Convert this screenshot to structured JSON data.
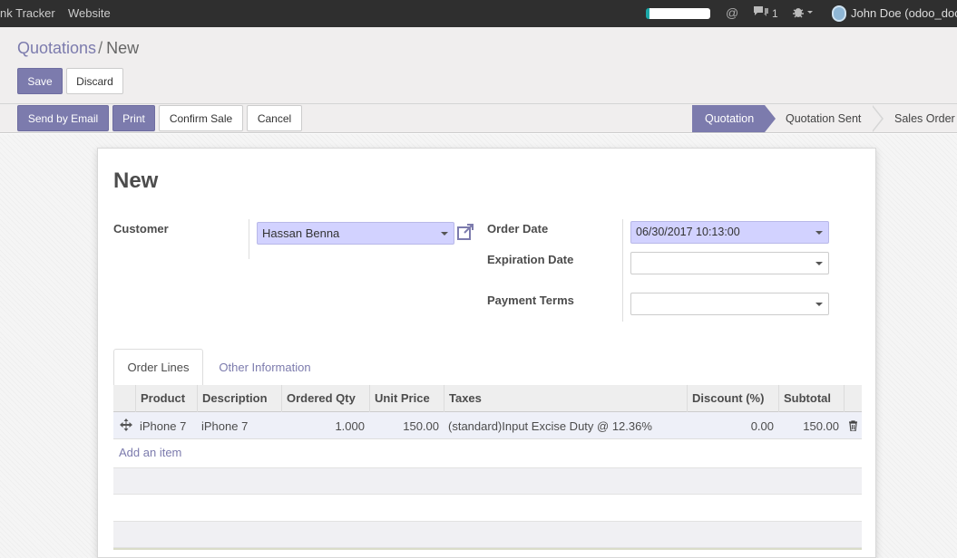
{
  "topbar": {
    "menu": [
      "nk Tracker",
      "Website"
    ],
    "chat_count": "1",
    "user": "John Doe (odoo_doc"
  },
  "breadcrumb": {
    "parent": "Quotations",
    "separator": "/",
    "current": "New"
  },
  "buttons": {
    "save": "Save",
    "discard": "Discard",
    "send_email": "Send by Email",
    "print": "Print",
    "confirm_sale": "Confirm Sale",
    "cancel": "Cancel"
  },
  "status": {
    "stages": [
      "Quotation",
      "Quotation Sent",
      "Sales Order"
    ],
    "active": "Quotation"
  },
  "form": {
    "title": "New",
    "customer_label": "Customer",
    "customer_value": "Hassan Benna",
    "order_date_label": "Order Date",
    "order_date_value": "06/30/2017 10:13:00",
    "expiration_label": "Expiration Date",
    "expiration_value": "",
    "payment_terms_label": "Payment Terms",
    "payment_terms_value": ""
  },
  "tabs": [
    {
      "label": "Order Lines",
      "active": true
    },
    {
      "label": "Other Information",
      "active": false
    }
  ],
  "order_lines": {
    "columns": [
      "Product",
      "Description",
      "Ordered Qty",
      "Unit Price",
      "Taxes",
      "Discount (%)",
      "Subtotal"
    ],
    "rows": [
      {
        "product": "iPhone 7",
        "description": "iPhone 7",
        "qty": "1.000",
        "unit_price": "150.00",
        "taxes": "(standard)Input Excise Duty @ 12.36%",
        "discount": "0.00",
        "subtotal": "150.00"
      }
    ],
    "add_item": "Add an item"
  },
  "colors": {
    "primary": "#7c7bad",
    "required_field": "#d2d2ff",
    "topbar": "#2f2f2f"
  }
}
